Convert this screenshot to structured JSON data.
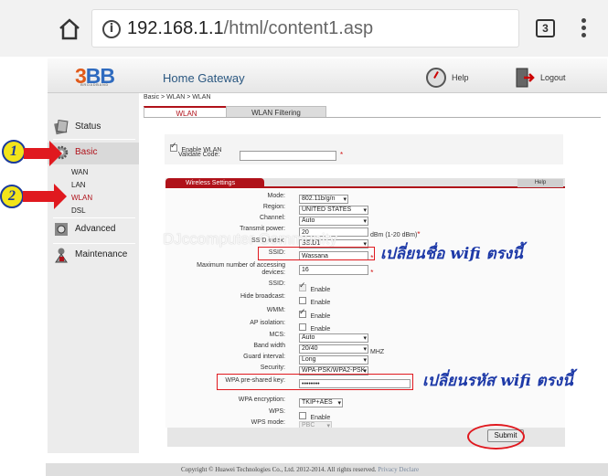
{
  "browser": {
    "url_host": "192.168.1.1",
    "url_path": "/html/content1.asp",
    "tab_count": "3"
  },
  "header": {
    "logo_text": "3BB",
    "logo_sub": "BROADBAND",
    "title": "Home Gateway",
    "help_label": "Help",
    "logout_label": "Logout"
  },
  "sidebar": {
    "status": "Status",
    "basic": "Basic",
    "basic_sub": [
      "WAN",
      "LAN",
      "WLAN",
      "DSL"
    ],
    "advanced": "Advanced",
    "maintenance": "Maintenance"
  },
  "annotations": {
    "badge1": "1",
    "badge2": "2",
    "watermark": "DJccomputer Community",
    "note_ssid": "เปลี่ยนชื่อ wifi ตรงนี้",
    "note_key": "เปลี่ยนรหัส wifi ตรงนี้"
  },
  "breadcrumb": "Basic > WLAN > WLAN",
  "tabs": [
    "WLAN",
    "WLAN Filtering"
  ],
  "basic_panel": {
    "enable_wlan_label": "Enable WLAN",
    "enable_wlan_checked": true,
    "validate_label": "Validate Code:",
    "validate_value": ""
  },
  "wireless": {
    "section_title": "Wireless Settings",
    "help_label": "Help",
    "mode_label": "Mode:",
    "mode": "802.11b/g/n",
    "region_label": "Region:",
    "region": "UNITED STATES",
    "channel_label": "Channel:",
    "channel": "Auto",
    "tx_label": "Transmit power:",
    "tx_value": "20",
    "tx_unit": "dBm (1-20 dBm)",
    "ssid_index_label": "SSID index:",
    "ssid_index": "SSID1",
    "ssid_name_label": "SSID:",
    "ssid_name": "Wassana",
    "max_label": "Maximum number of accessing devices:",
    "max_value": "16",
    "ssid_en_label": "SSID:",
    "ssid_en_text": "Enable",
    "hide_label": "Hide broadcast:",
    "hide_text": "Enable",
    "wmm_label": "WMM:",
    "wmm_text": "Enable",
    "ap_label": "AP isolation:",
    "ap_text": "Enable",
    "mcs_label": "MCS:",
    "mcs": "Auto",
    "bw_label": "Band width",
    "bw": "20/40",
    "bw_unit": "MHZ",
    "gi_label": "Guard interval:",
    "gi": "Long",
    "sec_label": "Security:",
    "sec": "WPA-PSK/WPA2-PSK",
    "wpa_key_label": "WPA pre-shared key:",
    "wpa_key": "••••••••",
    "enc_label": "WPA encryption:",
    "enc": "TKIP+AES",
    "wps_label": "WPS:",
    "wps_text": "Enable",
    "wps_mode_label": "WPS mode:",
    "wps_mode": "PBC",
    "submit": "Submit"
  },
  "footer": {
    "copyright": "Copyright © Huawei Technologies Co., Ltd. 2012-2014. All rights reserved.",
    "privacy": "Privacy Declare"
  }
}
